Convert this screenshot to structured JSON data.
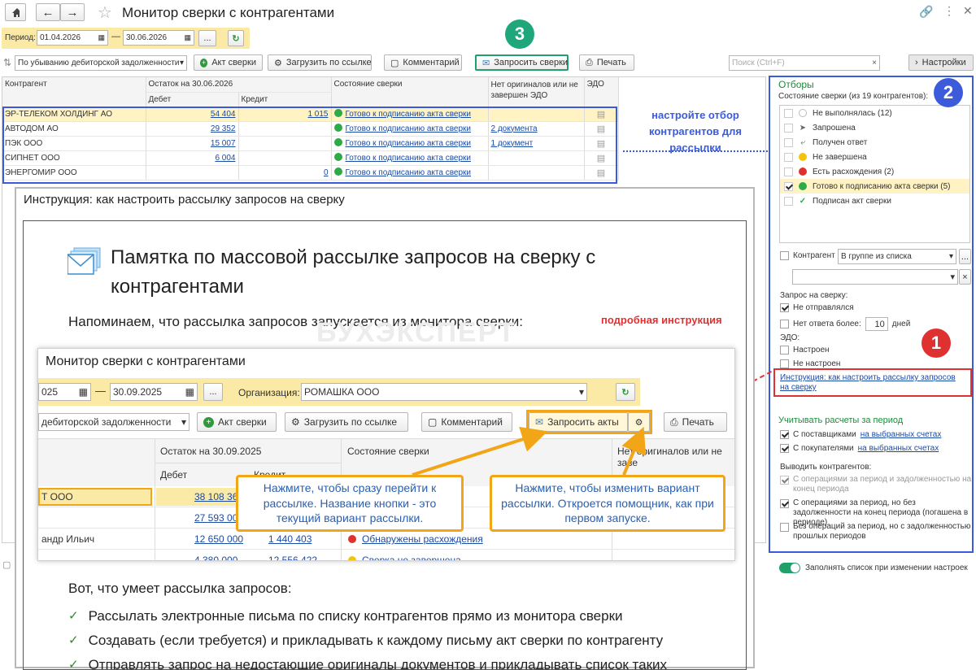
{
  "window": {
    "title": "Монитор сверки с контрагентами"
  },
  "period": {
    "label": "Период:",
    "from": "01.04.2026",
    "to": "30.06.2026",
    "dash": "—"
  },
  "toolbar": {
    "sort_value": "По убыванию дебиторской задолженности",
    "act_label": "Акт сверки",
    "load_label": "Загрузить по ссылке",
    "comment_label": "Комментарий",
    "request_label": "Запросить сверки",
    "print_label": "Печать",
    "search_placeholder": "Поиск (Ctrl+F)",
    "settings_label": "Настройки"
  },
  "table": {
    "col_counterparty": "Контрагент",
    "col_balance": "Остаток на 30.06.2026",
    "col_debit": "Дебет",
    "col_credit": "Кредит",
    "col_status": "Состояние сверки",
    "col_originals": "Нет оригиналов или не завершен ЭДО",
    "col_edo": "ЭДО",
    "rows": [
      {
        "name": "ЭР-ТЕЛЕКОМ ХОЛДИНГ АО",
        "debit": "54 404",
        "credit": "1 015",
        "status": "Готово к подписанию акта сверки",
        "originals": ""
      },
      {
        "name": "АВТОДОМ АО",
        "debit": "29 352",
        "credit": "",
        "status": "Готово к подписанию акта сверки",
        "originals": "2 документа"
      },
      {
        "name": "ПЭК ООО",
        "debit": "15 007",
        "credit": "",
        "status": "Готово к подписанию акта сверки",
        "originals": "1 документ"
      },
      {
        "name": "СИПНЕТ ООО",
        "debit": "6 004",
        "credit": "",
        "status": "Готово к подписанию акта сверки",
        "originals": ""
      },
      {
        "name": "ЭНЕРГОМИР ООО",
        "debit": "",
        "credit": "0",
        "status": "Готово к подписанию акта сверки",
        "originals": ""
      }
    ],
    "annotation": "настройте отбор контрагентов для рассылки"
  },
  "filters": {
    "title": "Отборы",
    "subtitle": "Состояние сверки (из 19 контрагентов):",
    "states": [
      {
        "label": "Не выполнялась (12)",
        "icon": "grey-circle-icon",
        "checked": false
      },
      {
        "label": "Запрошена",
        "icon": "send-icon",
        "checked": false
      },
      {
        "label": "Получен ответ",
        "icon": "reply-icon",
        "checked": false
      },
      {
        "label": "Не завершена",
        "icon": "yellow-circle-icon",
        "checked": false
      },
      {
        "label": "Есть расхождения (2)",
        "icon": "red-circle-icon",
        "checked": false
      },
      {
        "label": "Готово к подписанию акта сверки (5)",
        "icon": "green-circle-icon",
        "checked": true
      },
      {
        "label": "Подписан акт сверки",
        "icon": "check-icon",
        "checked": false
      }
    ],
    "counterparty_label": "Контрагент",
    "counterparty_mode": "В группе из списка",
    "request_title": "Запрос на сверку:",
    "not_sent": "Не отправлялся",
    "no_answer_prefix": "Нет ответа более:",
    "no_answer_days": "10",
    "no_answer_suffix": "дней",
    "edo_title": "ЭДО:",
    "edo_set": "Настроен",
    "edo_not_set": "Не настроен",
    "instruction_link": "Инструкция: как настроить рассылку запросов на сверку",
    "period_title": "Учитывать расчеты за период",
    "suppliers_label": "С поставщиками",
    "customers_label": "С покупателями",
    "selected_accounts": "на выбранных счетах",
    "output_title": "Выводить контрагентов:",
    "output_1": "С операциями за период и задолженностью на конец периода",
    "output_2": "С операциями за период, но без задолженности на конец периода (погашена в периоде)",
    "output_3": "Без операций за период, но с задолженностью прошлых периодов",
    "autofill_label": "Заполнять список при изменении настроек"
  },
  "markers": {
    "one": "1",
    "two": "2",
    "three": "3"
  },
  "instruction": {
    "title": "Инструкция: как настроить рассылку запросов на сверку",
    "memo_title": "Памятка по массовой рассылке запросов на сверку с контрагентами",
    "intro": "Напоминаем, что рассылка запросов запускается из монитора сверки:",
    "detail_link": "подробная инструкция",
    "watermark": "БУХЭКСПЕРТ",
    "shot": {
      "title": "Монитор сверки с контрагентами",
      "date_from": "025",
      "date_to": "30.09.2025",
      "org_label": "Организация:",
      "org_value": "РОМАШКА ООО",
      "sort": "дебиторской задолженности",
      "act": "Акт сверки",
      "load": "Загрузить по ссылке",
      "comment": "Комментарий",
      "request": "Запросить акты",
      "print": "Печать",
      "col_balance": "Остаток на 30.09.2025",
      "col_status": "Состояние сверки",
      "col_originals": "Нет оригиналов или не заве",
      "col_debit": "Дебет",
      "col_credit": "Кредит",
      "rows": [
        {
          "name": "Т ООО",
          "debit": "38 108 36"
        },
        {
          "name": "",
          "debit": "27 593 00"
        },
        {
          "name": "андр Ильич",
          "debit": "12 650 000",
          "credit": "1 440 403",
          "status": "Обнаружены расхождения"
        },
        {
          "name": "",
          "debit": "4 380 000",
          "credit": "12 556 422",
          "status": "Сверка не завершена"
        }
      ],
      "callout_left": "Нажмите, чтобы сразу перейти к рассылке. Название кнопки - это текущий вариант рассылки.",
      "callout_right": "Нажмите, чтобы изменить вариант рассылки. Откроется помощник, как при первом запуске."
    },
    "features_title": "Вот, что умеет рассылка запросов:",
    "features": [
      "Рассылать электронные письма по списку контрагентов прямо из монитора сверки",
      "Создавать (если требуется) и прикладывать к каждому письму акт сверки по контрагенту",
      "Отправлять запрос на недостающие оригиналы документов и прикладывать список таких"
    ]
  },
  "colors": {
    "accent_blue": "#3b5bdb",
    "green": "#22a06b",
    "red_marker": "#e03131",
    "callout_orange": "#f2a516",
    "highlight": "#fff3c4"
  }
}
